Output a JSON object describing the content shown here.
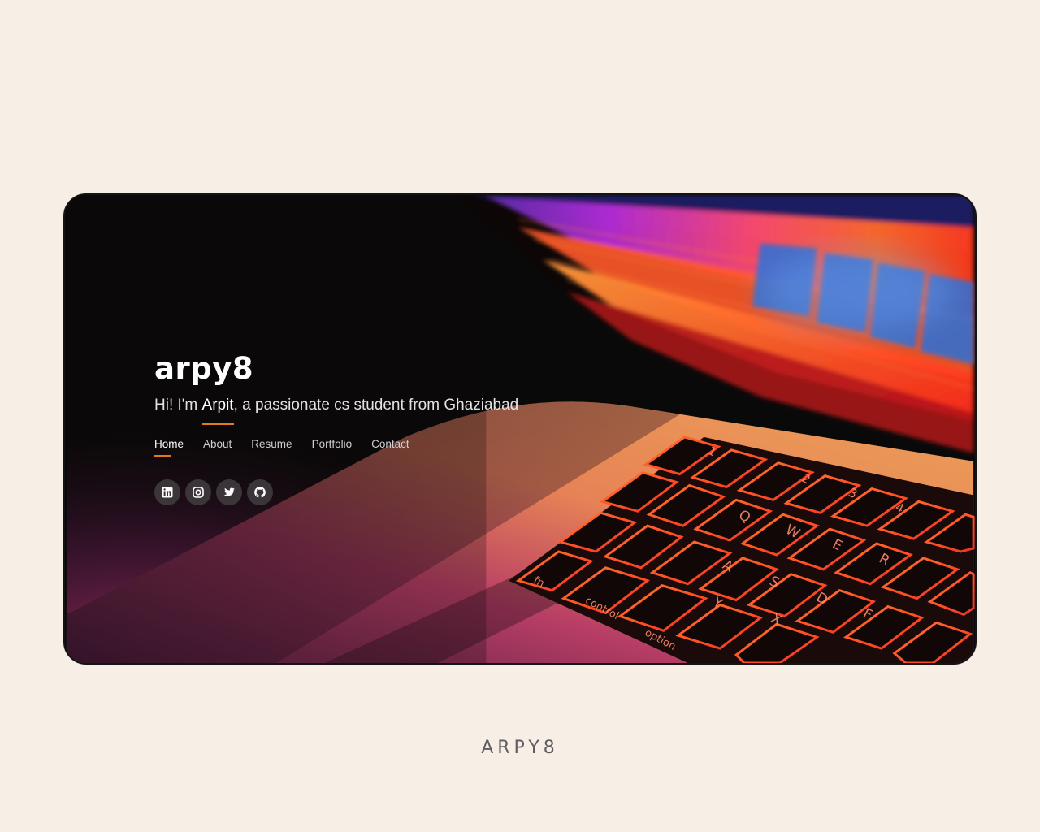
{
  "hero": {
    "brand": "arpy8",
    "greeting_prefix": "Hi! I'm ",
    "greeting_name": "Arpit",
    "greeting_suffix": ", a passionate cs student from Ghaziabad"
  },
  "nav": {
    "items": [
      {
        "label": "Home",
        "active": true
      },
      {
        "label": "About"
      },
      {
        "label": "Resume"
      },
      {
        "label": "Portfolio"
      },
      {
        "label": "Contact"
      }
    ]
  },
  "social": [
    {
      "icon": "linkedin-icon"
    },
    {
      "icon": "instagram-icon"
    },
    {
      "icon": "twitter-icon"
    },
    {
      "icon": "github-icon"
    }
  ],
  "background": {
    "keyboard_keys": [
      "fn",
      "control",
      "option",
      "A",
      "S",
      "D",
      "F",
      "Q",
      "W",
      "E",
      "R",
      "X",
      "Y",
      "1",
      "2",
      "3",
      "4"
    ]
  },
  "footer": {
    "brand": "ARPY8"
  },
  "colors": {
    "page_background": "#f7eee6",
    "accent": "#e2791f",
    "card_background": "#0a0909",
    "footer_text": "#5e5e62"
  }
}
